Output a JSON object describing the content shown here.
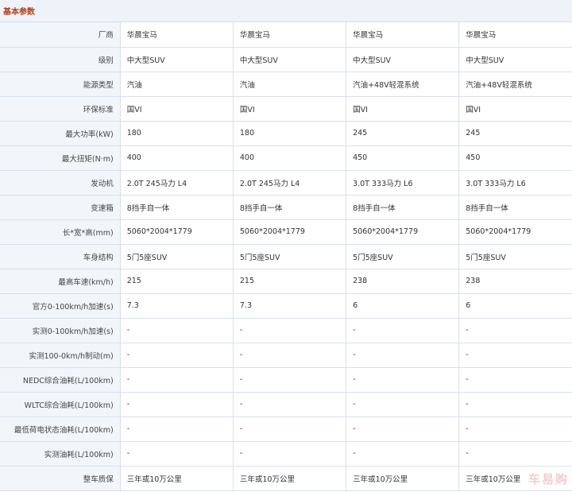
{
  "section": {
    "title": "基本参数"
  },
  "rows": [
    {
      "label": "厂商",
      "values": [
        "华晨宝马",
        "华晨宝马",
        "华晨宝马",
        "华晨宝马"
      ]
    },
    {
      "label": "级别",
      "values": [
        "中大型SUV",
        "中大型SUV",
        "中大型SUV",
        "中大型SUV"
      ]
    },
    {
      "label": "能源类型",
      "values": [
        "汽油",
        "汽油",
        "汽油+48V轻混系统",
        "汽油+48V轻混系统"
      ]
    },
    {
      "label": "环保标准",
      "values": [
        "国VI",
        "国VI",
        "国VI",
        "国VI"
      ]
    },
    {
      "label": "最大功率(kW)",
      "values": [
        "180",
        "180",
        "245",
        "245"
      ]
    },
    {
      "label": "最大扭矩(N·m)",
      "values": [
        "400",
        "400",
        "450",
        "450"
      ]
    },
    {
      "label": "发动机",
      "values": [
        "2.0T 245马力 L4",
        "2.0T 245马力 L4",
        "3.0T 333马力 L6",
        "3.0T 333马力 L6"
      ]
    },
    {
      "label": "变速箱",
      "values": [
        "8挡手自一体",
        "8挡手自一体",
        "8挡手自一体",
        "8挡手自一体"
      ]
    },
    {
      "label": "长*宽*高(mm)",
      "values": [
        "5060*2004*1779",
        "5060*2004*1779",
        "5060*2004*1779",
        "5060*2004*1779"
      ]
    },
    {
      "label": "车身结构",
      "values": [
        "5门5座SUV",
        "5门5座SUV",
        "5门5座SUV",
        "5门5座SUV"
      ]
    },
    {
      "label": "最高车速(km/h)",
      "values": [
        "215",
        "215",
        "238",
        "238"
      ]
    },
    {
      "label": "官方0-100km/h加速(s)",
      "values": [
        "7.3",
        "7.3",
        "6",
        "6"
      ]
    },
    {
      "label": "实测0-100km/h加速(s)",
      "values": [
        "-",
        "-",
        "-",
        "-"
      ]
    },
    {
      "label": "实测100-0km/h制动(m)",
      "values": [
        "-",
        "-",
        "-",
        "-"
      ]
    },
    {
      "label": "NEDC综合油耗(L/100km)",
      "values": [
        "-",
        "-",
        "-",
        "-"
      ]
    },
    {
      "label": "WLTC综合油耗(L/100km)",
      "values": [
        "-",
        "-",
        "-",
        "-"
      ]
    },
    {
      "label": "最低荷电状态油耗(L/100km)",
      "values": [
        "-",
        "-",
        "-",
        "-"
      ]
    },
    {
      "label": "实测油耗(L/100km)",
      "values": [
        "-",
        "-",
        "-",
        "-"
      ]
    },
    {
      "label": "整车质保",
      "values": [
        "三年或10万公里",
        "三年或10万公里",
        "三年或10万公里",
        "三年或10万公里"
      ]
    }
  ],
  "watermark": "车易购"
}
